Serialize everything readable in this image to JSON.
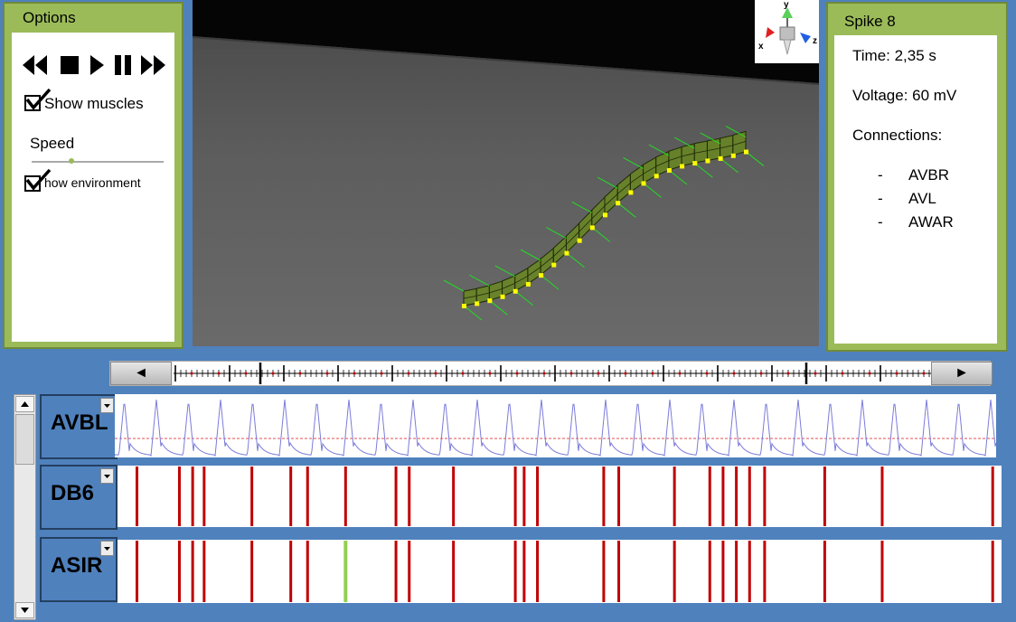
{
  "options": {
    "title": "Options",
    "controls": [
      "rewind",
      "stop",
      "play",
      "pause",
      "fast-forward"
    ],
    "show_muscles": {
      "label": "Show muscles",
      "checked": true
    },
    "speed": {
      "label": "Speed",
      "value_fraction": 0.3
    },
    "show_environment": {
      "label": "how environment",
      "checked": true
    }
  },
  "spike": {
    "title": "Spike 8",
    "time": "Time: 2,35 s",
    "voltage": "Voltage: 60 mV",
    "connections_label": "Connections:",
    "connections": [
      {
        "dash": "-",
        "name": "AVBR"
      },
      {
        "dash": "-",
        "name": "AVL"
      },
      {
        "dash": "-",
        "name": "AWAR"
      }
    ]
  },
  "axis_gizmo": {
    "y": "y",
    "x": "x",
    "z": "z"
  },
  "timeline": {
    "left_button": "◄",
    "right_button": "►"
  },
  "neurons": [
    {
      "name": "AVBL",
      "display": "voltage-trace",
      "trace_color": "#7b7bdb",
      "threshold_color": "#e05050"
    },
    {
      "name": "DB6",
      "display": "spike-raster",
      "spike_color": "#c00000",
      "spike_times": [
        0.022,
        0.07,
        0.085,
        0.098,
        0.152,
        0.196,
        0.215,
        0.258,
        0.315,
        0.33,
        0.38,
        0.45,
        0.46,
        0.475,
        0.55,
        0.567,
        0.63,
        0.67,
        0.685,
        0.7,
        0.715,
        0.732,
        0.8,
        0.865,
        0.99
      ]
    },
    {
      "name": "ASIR",
      "display": "spike-raster",
      "spike_color": "#c00000",
      "highlight_color": "#92d050",
      "highlight_index": 7,
      "spike_times": [
        0.022,
        0.07,
        0.085,
        0.098,
        0.152,
        0.196,
        0.215,
        0.258,
        0.315,
        0.33,
        0.38,
        0.45,
        0.46,
        0.475,
        0.55,
        0.567,
        0.63,
        0.67,
        0.685,
        0.7,
        0.715,
        0.732,
        0.8,
        0.865,
        0.99
      ]
    }
  ],
  "colors": {
    "background": "#4f81bd",
    "panel_green": "#9bbb59",
    "worm": "#6b8c1a",
    "muscle_markers": "#ffff00",
    "force_lines": "#22dd22"
  }
}
